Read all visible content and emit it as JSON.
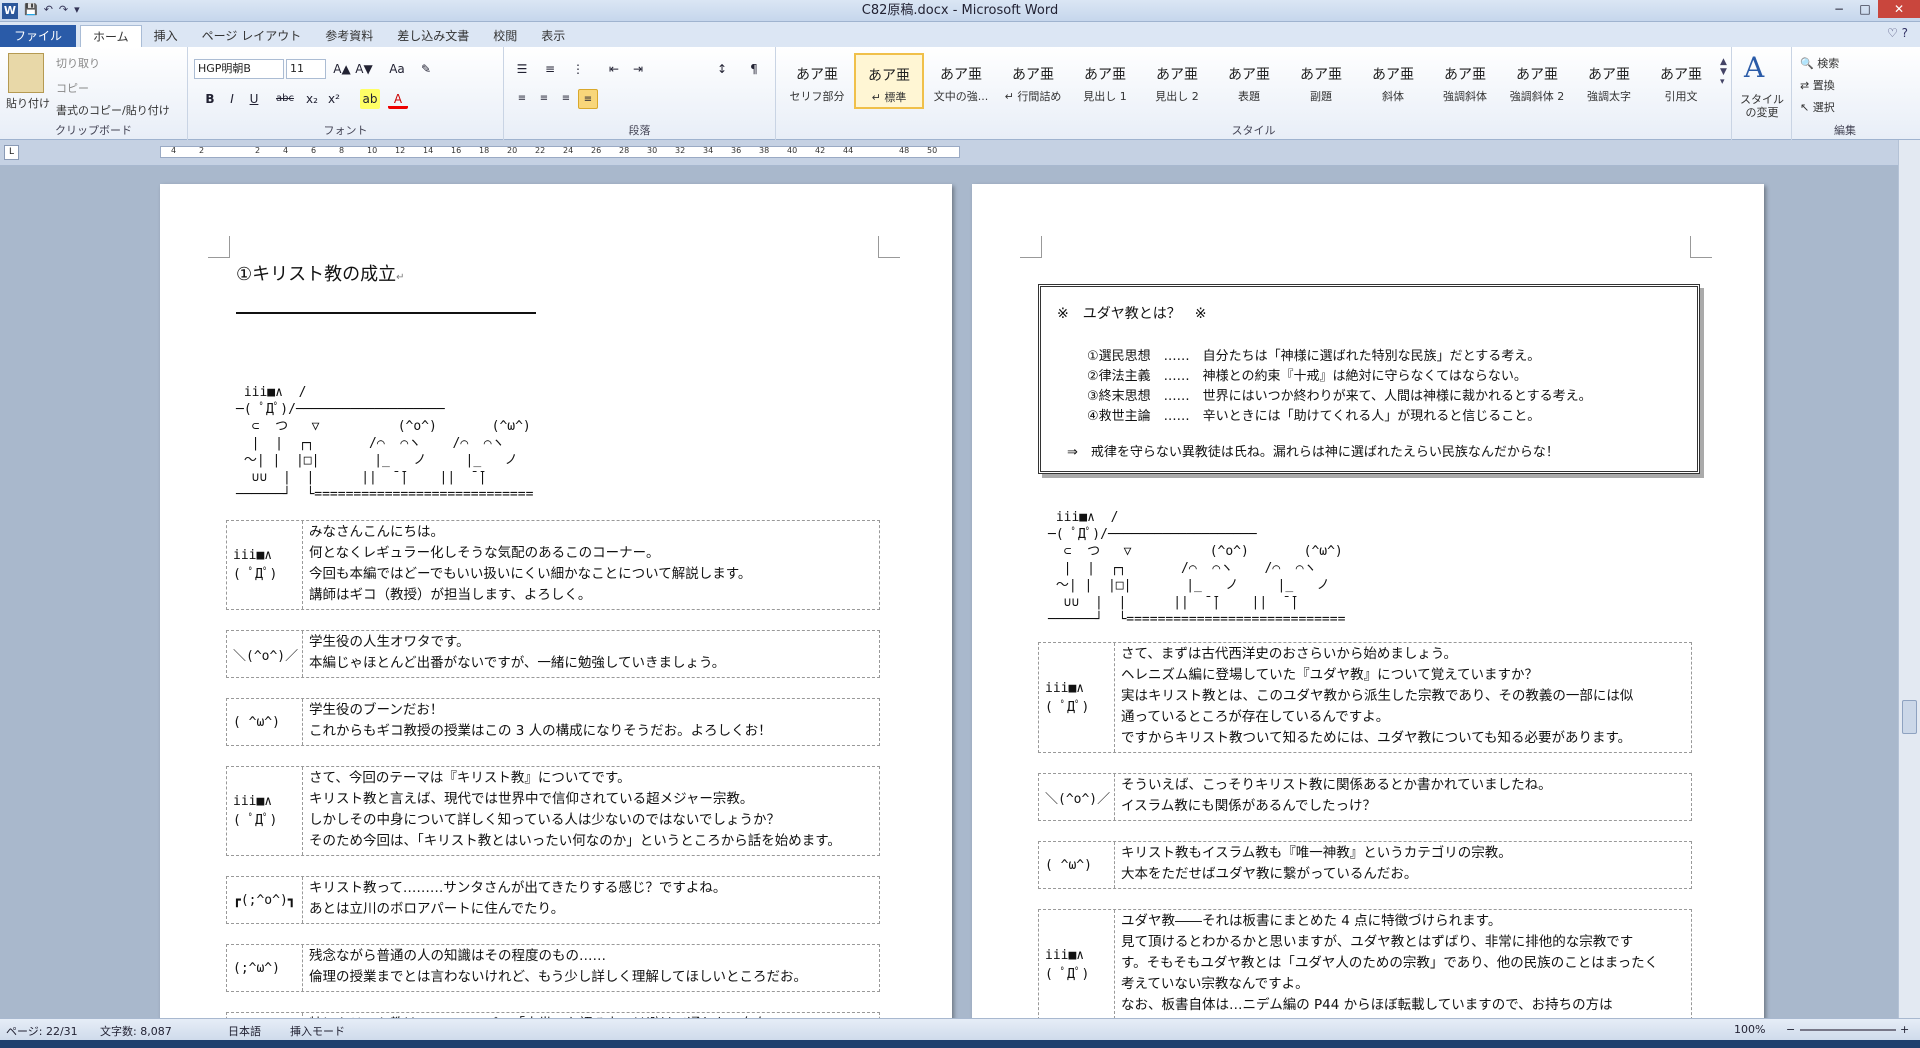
{
  "window": {
    "title": "C82原稿.docx - Microsoft Word",
    "app_icon": "W"
  },
  "qat": {
    "save": "💾",
    "undo": "↶",
    "redo": "↷",
    "more": "▾"
  },
  "winctl": {
    "min": "−",
    "max": "□",
    "close": "✕"
  },
  "tabs": [
    "ファイル",
    "ホーム",
    "挿入",
    "ページ レイアウト",
    "参考資料",
    "差し込み文書",
    "校閲",
    "表示"
  ],
  "help": "♡ ?",
  "clipboard": {
    "paste": "貼り付け",
    "cut": "切り取り",
    "copy": "コピー",
    "format_painter": "書式のコピー/貼り付け",
    "label": "クリップボード"
  },
  "font": {
    "name": "HGP明朝B",
    "size": "11",
    "label": "フォント",
    "bold": "B",
    "italic": "I",
    "underline": "U",
    "strike": "abc",
    "sub": "x₂",
    "sup": "x²",
    "grow": "A▲",
    "shrink": "A▼",
    "case": "Aa",
    "clear": "✎",
    "color": "A",
    "highlight": "ab"
  },
  "paragraph": {
    "label": "段落",
    "bullets": "☰",
    "numbers": "≡",
    "multi": "⋮",
    "dec": "⇤",
    "inc": "⇥",
    "sort": "↕",
    "marks": "¶"
  },
  "styles": {
    "label": "スタイル",
    "items": [
      {
        "preview": "あア亜",
        "name": "セリフ部分"
      },
      {
        "preview": "あア亜",
        "name": "↵ 標準"
      },
      {
        "preview": "あア亜",
        "name": "文中の強..."
      },
      {
        "preview": "あア亜",
        "name": "↵ 行間詰め"
      },
      {
        "preview": "あア亜",
        "name": "見出し 1"
      },
      {
        "preview": "あア亜",
        "name": "見出し 2"
      },
      {
        "preview": "あア亜",
        "name": "表題"
      },
      {
        "preview": "あア亜",
        "name": "副題"
      },
      {
        "preview": "あア亜",
        "name": "斜体"
      },
      {
        "preview": "あア亜",
        "name": "強調斜体"
      },
      {
        "preview": "あア亜",
        "name": "強調斜体 2"
      },
      {
        "preview": "あア亜",
        "name": "強調太字"
      },
      {
        "preview": "あア亜",
        "name": "引用文"
      }
    ],
    "change": "スタイルの変更"
  },
  "editing": {
    "label": "編集",
    "find": "検索",
    "replace": "置換",
    "select": "選択"
  },
  "ruler": {
    "ticks": [
      "4",
      "2",
      "",
      "2",
      "4",
      "6",
      "8",
      "10",
      "12",
      "14",
      "16",
      "18",
      "20",
      "22",
      "24",
      "26",
      "28",
      "30",
      "32",
      "34",
      "36",
      "38",
      "40",
      "42",
      "44",
      "",
      "48",
      "50"
    ]
  },
  "page1": {
    "heading": "①キリスト教の成立",
    "ascii_top": " iii■∧  /\n─( ﾟДﾟ)/───────────────────\n  ⊂  つ   ▽          (^o^)       (^ω^)\n  |  |  ┌┐       /⌒  ⌒ヽ    /⌒  ⌒ヽ\n ～| |  |□|       |_   ノ     |_   ノ\n  ∪∪  |  |      ||  ̄ ̄|    ||  ̄ ̄|\n──────┘  └============================",
    "dialogs": [
      {
        "face": "iii■∧\n( ﾟДﾟ)",
        "lines": [
          "みなさんこんにちは。",
          "何となくレギュラー化しそうな気配のあるこのコーナー。",
          "今回も本編ではどーでもいい扱いにくい細かなことについて解説します。",
          "講師はギコ（教授）が担当します、よろしく。"
        ]
      },
      {
        "face": "＼(^o^)／",
        "lines": [
          "学生役の人生オワタです。",
          "本編じゃほとんど出番がないですが、一緒に勉強していきましょう。"
        ]
      },
      {
        "face": "( ^ω^)",
        "lines": [
          "学生役のブーンだお！",
          "これからもギコ教授の授業はこの 3 人の構成になりそうだお。よろしくお！"
        ]
      },
      {
        "face": "iii■∧\n( ﾟДﾟ)",
        "lines": [
          "さて、今回のテーマは『キリスト教』についてです。",
          "キリスト教と言えば、現代では世界中で信仰されている超メジャー宗教。",
          "しかしその中身について詳しく知っている人は少ないのではないでしょうか？",
          "そのため今回は、「キリスト教とはいったい何なのか」というところから話を始めます。"
        ]
      },
      {
        "face": "┏(;^o^)┓",
        "lines": [
          "キリスト教って………サンタさんが出てきたりする感じ？ですよね。",
          "あとは立川のボロアパートに住んでたり。"
        ]
      },
      {
        "face": "(;^ω^)",
        "lines": [
          "残念ながら普通の人の知識はその程度のもの……",
          "倫理の授業までとは言わないけれど、もう少し詳しく理解してほしいところだお。"
        ]
      },
      {
        "face": "",
        "lines": [
          "特にキリスト教は、ヨーロッパの「中世」を語る上では避けて通れない存在"
        ]
      }
    ]
  },
  "page2": {
    "box_title": "※　ユダヤ教とは？　※",
    "tenets": [
      "①選民思想　……　自分たちは「神様に選ばれた特別な民族」だとする考え。",
      "②律法主義　……　神様との約束『十戒』は絶対に守らなくてはならない。",
      "③終末思想　……　世界にはいつか終わりが来て、人間は神様に裁かれるとする考え。",
      "④救世主論　……　辛いときには「助けてくれる人」が現れると信じること。"
    ],
    "conclusion": "⇒　戒律を守らない異教徒は氏ね。漏れらは神に選ばれたえらい民族なんだからな！",
    "dialogs": [
      {
        "face": "iii■∧\n( ﾟДﾟ)",
        "lines": [
          "さて、まずは古代西洋史のおさらいから始めましょう。",
          "ヘレニズム編に登場していた『ユダヤ教』について覚えていますか？",
          "実はキリスト教とは、このユダヤ教から派生した宗教であり、その教義の一部には似",
          "通っているところが存在しているんですよ。",
          "ですからキリスト教ついて知るためには、ユダヤ教についても知る必要があります。"
        ]
      },
      {
        "face": "＼(^o^)／",
        "lines": [
          "そういえば、こっそりキリスト教に関係あるとか書かれていましたね。",
          "イスラム教にも関係があるんでしたっけ？"
        ]
      },
      {
        "face": "( ^ω^)",
        "lines": [
          "キリスト教もイスラム教も『唯一神教』というカテゴリの宗教。",
          "大本をただせばユダヤ教に繋がっているんだお。"
        ]
      },
      {
        "face": "iii■∧\n( ﾟДﾟ)",
        "lines": [
          "ユダヤ教――それは板書にまとめた 4 点に特徴づけられます。",
          "見て頂けるとわかるかと思いますが、ユダヤ教とはずばり、非常に排他的な宗教です",
          "す。そもそもユダヤ教とは「ユダヤ人のための宗教」であり、他の民族のことはまったく",
          "考えていない宗教なんですよ。",
          "なお、板書自体は…ニデム編の P44 からほぼ転載していますので、お持ちの方は"
        ]
      }
    ]
  },
  "status": {
    "page": "ページ: 22/31",
    "words": "文字数: 8,087",
    "lang": "日本語",
    "mode": "挿入モード",
    "zoom": "100%",
    "minus": "−",
    "plus": "+"
  },
  "para_mark": "↵"
}
